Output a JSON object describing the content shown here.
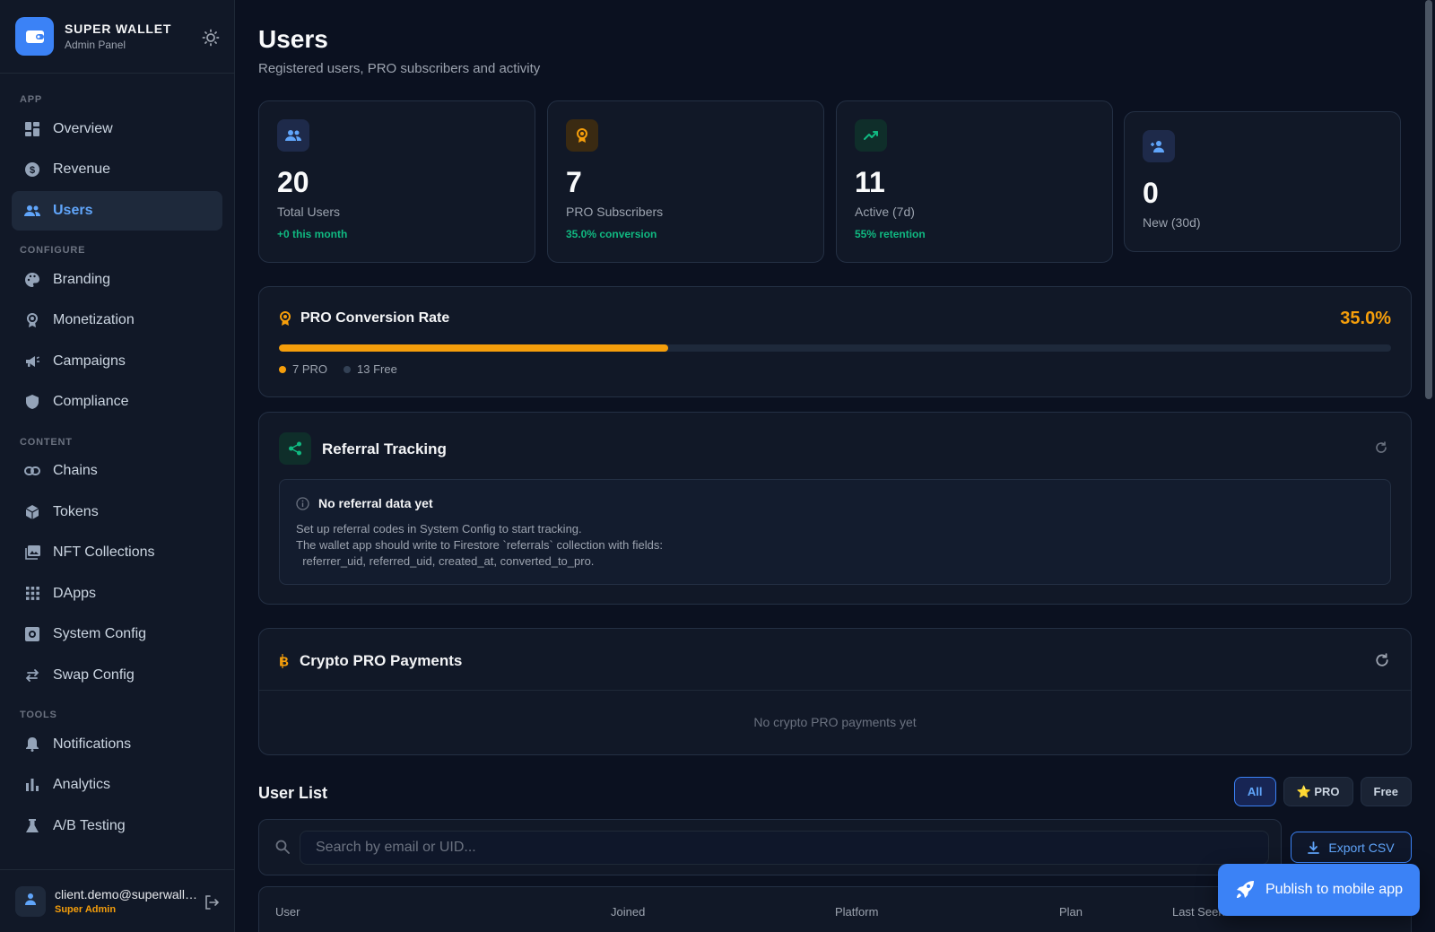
{
  "brand": {
    "title": "SUPER WALLET",
    "subtitle": "Admin Panel",
    "logo_icon": "wallet-icon",
    "theme_icon": "sun-icon"
  },
  "nav": {
    "sections": {
      "app": "APP",
      "configure": "CONFIGURE",
      "content": "CONTENT",
      "tools": "TOOLS"
    },
    "items": [
      {
        "label": "Overview",
        "icon": "grid-icon"
      },
      {
        "label": "Revenue",
        "icon": "dollar-icon"
      },
      {
        "label": "Users",
        "icon": "users-icon",
        "active": true
      },
      {
        "label": "Branding",
        "icon": "palette-icon"
      },
      {
        "label": "Monetization",
        "icon": "award-icon"
      },
      {
        "label": "Campaigns",
        "icon": "megaphone-icon"
      },
      {
        "label": "Compliance",
        "icon": "shield-icon"
      },
      {
        "label": "Chains",
        "icon": "link-icon"
      },
      {
        "label": "Tokens",
        "icon": "cube-icon"
      },
      {
        "label": "NFT Collections",
        "icon": "images-icon"
      },
      {
        "label": "DApps",
        "icon": "apps-icon"
      },
      {
        "label": "System Config",
        "icon": "settings-icon"
      },
      {
        "label": "Swap Config",
        "icon": "swap-icon"
      },
      {
        "label": "Notifications",
        "icon": "bell-icon"
      },
      {
        "label": "Analytics",
        "icon": "bar-chart-icon"
      },
      {
        "label": "A/B Testing",
        "icon": "flask-icon"
      }
    ]
  },
  "account": {
    "email": "client.demo@superwallet.app",
    "role": "Super Admin"
  },
  "page": {
    "title": "Users",
    "subtitle": "Registered users, PRO subscribers and activity"
  },
  "stats": [
    {
      "value": "20",
      "label": "Total Users",
      "sub": "+0 this month",
      "icon": "users-icon",
      "color": "#60a5fa"
    },
    {
      "value": "7",
      "label": "PRO Subscribers",
      "sub": "35.0% conversion",
      "icon": "award-icon",
      "color": "#f59e0b"
    },
    {
      "value": "11",
      "label": "Active (7d)",
      "sub": "55% retention",
      "icon": "trending-up-icon",
      "color": "#10b981"
    },
    {
      "value": "0",
      "label": "New (30d)",
      "sub": "",
      "icon": "user-plus-icon",
      "color": "#60a5fa"
    }
  ],
  "conversion": {
    "title": "PRO Conversion Rate",
    "percent_label": "35.0%",
    "fraction": 0.35,
    "pro_label": "7 PRO",
    "free_label": "13 Free",
    "pro_color": "#f59e0b",
    "free_color": "#334155"
  },
  "referral": {
    "title": "Referral Tracking",
    "empty_title": "No referral data yet",
    "empty_lines": "Set up referral codes in System Config to start tracking.\nThe wallet app should write to Firestore `referrals` collection with fields:\n  referrer_uid, referred_uid, created_at, converted_to_pro."
  },
  "crypto": {
    "title": "Crypto PRO Payments",
    "empty": "No crypto PRO payments yet"
  },
  "user_list": {
    "title": "User List",
    "filters": {
      "all": "All",
      "pro": "⭐ PRO",
      "free": "Free"
    },
    "search_placeholder": "Search by email or UID...",
    "search_value": "",
    "export_label": "Export CSV",
    "columns": [
      "User",
      "Joined",
      "Platform",
      "Plan",
      "Last Seen"
    ]
  },
  "publish": {
    "label": "Publish to mobile app",
    "icon": "rocket-icon"
  },
  "colors": {
    "accent": "#3b82f6",
    "pro": "#f59e0b",
    "success": "#10b981"
  }
}
